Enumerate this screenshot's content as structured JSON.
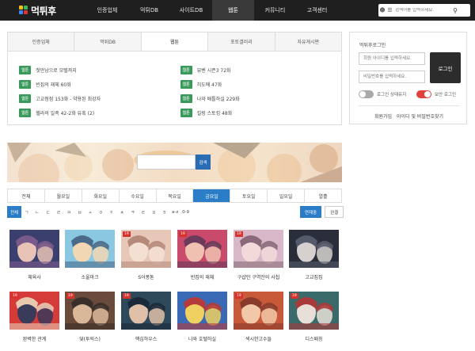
{
  "nav": {
    "logo_text": "먹튀후",
    "items": [
      "인증업체",
      "먹튀DB",
      "사이트DB",
      "웹툰",
      "커뮤니티",
      "고객센터"
    ],
    "active_index": 3,
    "search_placeholder": "검색어를 입력하세요."
  },
  "panel": {
    "tabs": [
      "인증업체",
      "먹튀DB",
      "웹툰",
      "포토갤러리",
      "자유게시판"
    ],
    "active_tab": 2,
    "left_items": [
      {
        "badge": "웹툰",
        "text": "첫만남으로 모텔까지"
      },
      {
        "badge": "웹툰",
        "text": "빈집의 재체 60화"
      },
      {
        "badge": "웹툰",
        "text": "고교점점 153화 - 약용된 최강자"
      },
      {
        "badge": "웹툰",
        "text": "헬라의 일족 42-2화 유혹 (2)"
      }
    ],
    "right_items": [
      {
        "badge": "웹툰",
        "text": "뷰벤 시즌3 72화"
      },
      {
        "badge": "웹툰",
        "text": "히도메 47화"
      },
      {
        "badge": "웹툰",
        "text": "나와 배틀하실 229화"
      },
      {
        "badge": "웹툰",
        "text": "킬링 스토킹 48화"
      }
    ]
  },
  "login": {
    "title": "먹튀후로그인",
    "id_placeholder": "회원 아이디를 입력하세요.",
    "pw_placeholder": "비밀번호를 입력하세요.",
    "button": "로그인",
    "keep_login": "로그인 상태유지",
    "secure_login": "보안 로그인",
    "links": [
      "회원가입",
      "아이디 및 비밀번호찾기"
    ]
  },
  "banner": {
    "search_button": "검색"
  },
  "days": {
    "items": [
      "전체",
      "월요일",
      "화요일",
      "수요일",
      "목요일",
      "금요일",
      "토요일",
      "일요일",
      "열흘"
    ],
    "active_index": 5
  },
  "letters": {
    "items": [
      "전체",
      "ㄱ",
      "ㄴ",
      "ㄷ",
      "ㄹ",
      "ㅁ",
      "ㅂ",
      "ㅅ",
      "ㅇ",
      "ㅈ",
      "ㅊ",
      "ㅋ",
      "ㅌ",
      "ㅍ",
      "ㅎ",
      "a-z",
      "0-9"
    ],
    "active_index": 0,
    "sort": [
      "연재중",
      "완결"
    ],
    "active_sort": 0
  },
  "webtoons": [
    {
      "title": "체육사",
      "age": "",
      "colors": [
        "#3b3f6e",
        "#e9c3b5",
        "#7a5a8a"
      ]
    },
    {
      "title": "소울마크",
      "age": "",
      "colors": [
        "#8ac7e0",
        "#f2d7b3",
        "#4a6a8a"
      ]
    },
    {
      "title": "S어퐁톤",
      "age": "19",
      "colors": [
        "#e7c7b8",
        "#f3e0d3",
        "#b58a7a"
      ]
    },
    {
      "title": "빈집의 재체",
      "age": "19",
      "colors": [
        "#c94a6b",
        "#f0c1b0",
        "#6a3b5a"
      ]
    },
    {
      "title": "구샵인 구역잔의 사칩",
      "age": "19",
      "colors": [
        "#d8b8c8",
        "#f2dada",
        "#8a6a7a"
      ]
    },
    {
      "title": "고교집집",
      "age": "",
      "colors": [
        "#2a2e3a",
        "#d6d1cf",
        "#555a6a"
      ]
    },
    {
      "title": "완벽한 관계",
      "age": "19",
      "colors": [
        "#d53b39",
        "#3a3a5a",
        "#e9c8b0"
      ]
    },
    {
      "title": "덫(투릭스)",
      "age": "19",
      "colors": [
        "#6a4a3a",
        "#d9b89a",
        "#3a2e2a"
      ]
    },
    {
      "title": "핵심하우스",
      "age": "19",
      "colors": [
        "#2e4a5a",
        "#e0c0a8",
        "#1a2a3a"
      ]
    },
    {
      "title": "나와 호텔하실",
      "age": "",
      "colors": [
        "#3a6ab5",
        "#f0d060",
        "#b53a3a"
      ]
    },
    {
      "title": "섹시한고수들",
      "age": "19",
      "colors": [
        "#c85a3a",
        "#f2c8a8",
        "#8a3a2a"
      ]
    },
    {
      "title": "디스패칭",
      "age": "19",
      "colors": [
        "#3a6a6a",
        "#e8e0d8",
        "#aa3a3a"
      ]
    }
  ]
}
